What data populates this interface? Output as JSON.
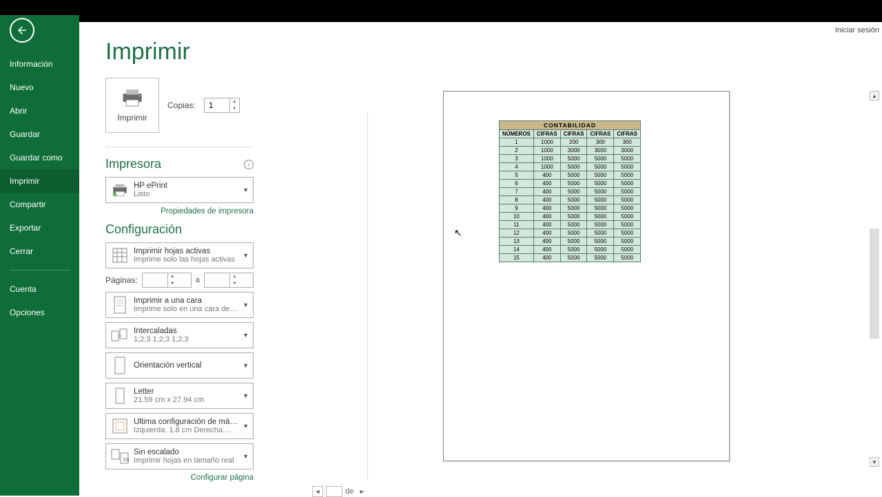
{
  "header": {
    "signin": "Iniciar sesión"
  },
  "sidebar": {
    "items": [
      {
        "label": "Información"
      },
      {
        "label": "Nuevo"
      },
      {
        "label": "Abrir"
      },
      {
        "label": "Guardar"
      },
      {
        "label": "Guardar como"
      },
      {
        "label": "Imprimir"
      },
      {
        "label": "Compartir"
      },
      {
        "label": "Exportar"
      },
      {
        "label": "Cerrar"
      }
    ],
    "bottom": [
      {
        "label": "Cuenta"
      },
      {
        "label": "Opciones"
      }
    ]
  },
  "page_title": "Imprimir",
  "print_button": "Imprimir",
  "copies": {
    "label": "Copias:",
    "value": "1"
  },
  "printer_section": {
    "title": "Impresora",
    "selected": {
      "name": "HP ePrint",
      "status": "Listo"
    },
    "props_link": "Propiedades de impresora"
  },
  "config_section": {
    "title": "Configuración",
    "active_sheets": {
      "line1": "Imprimir hojas activas",
      "line2": "Imprime solo las hojas activas"
    },
    "pages": {
      "label": "Páginas:",
      "sep": "a"
    },
    "one_side": {
      "line1": "Imprimir a una cara",
      "line2": "Imprime solo en una cara de…"
    },
    "collated": {
      "line1": "Intercaladas",
      "line2": "1;2;3    1;2;3    1;2;3"
    },
    "orientation": {
      "line1": "Orientación vertical",
      "line2": ""
    },
    "paper": {
      "line1": "Letter",
      "line2": "21.59 cm x 27.94 cm"
    },
    "margins": {
      "line1": "Última configuración de má…",
      "line2": "Izquierda:  1.8 cm    Derecha:…"
    },
    "scaling": {
      "line1": "Sin escalado",
      "line2": "Imprimir hojas en tamaño real"
    },
    "page_setup_link": "Configurar página"
  },
  "page_nav": {
    "current": "",
    "of_label": "de"
  },
  "chart_data": {
    "type": "table",
    "title": "CONTABILIDAD",
    "columns": [
      "NÚMEROS",
      "CIFRAS",
      "CIFRAS",
      "CIFRAS",
      "CIFRAS"
    ],
    "rows": [
      [
        "1",
        "1000",
        "200",
        "300",
        "300"
      ],
      [
        "2",
        "1000",
        "3000",
        "3000",
        "3000"
      ],
      [
        "3",
        "1000",
        "5000",
        "5000",
        "5000"
      ],
      [
        "4",
        "1000",
        "5000",
        "5000",
        "5000"
      ],
      [
        "5",
        "400",
        "5000",
        "5000",
        "5000"
      ],
      [
        "6",
        "400",
        "5000",
        "5000",
        "5000"
      ],
      [
        "7",
        "400",
        "5000",
        "5000",
        "5000"
      ],
      [
        "8",
        "400",
        "5000",
        "5000",
        "5000"
      ],
      [
        "9",
        "400",
        "5000",
        "5000",
        "5000"
      ],
      [
        "10",
        "400",
        "5000",
        "5000",
        "5000"
      ],
      [
        "11",
        "400",
        "5000",
        "5000",
        "5000"
      ],
      [
        "12",
        "400",
        "5000",
        "5000",
        "5000"
      ],
      [
        "13",
        "400",
        "5000",
        "5000",
        "5000"
      ],
      [
        "14",
        "400",
        "5000",
        "5000",
        "5000"
      ],
      [
        "15",
        "400",
        "5000",
        "5000",
        "5000"
      ]
    ]
  }
}
